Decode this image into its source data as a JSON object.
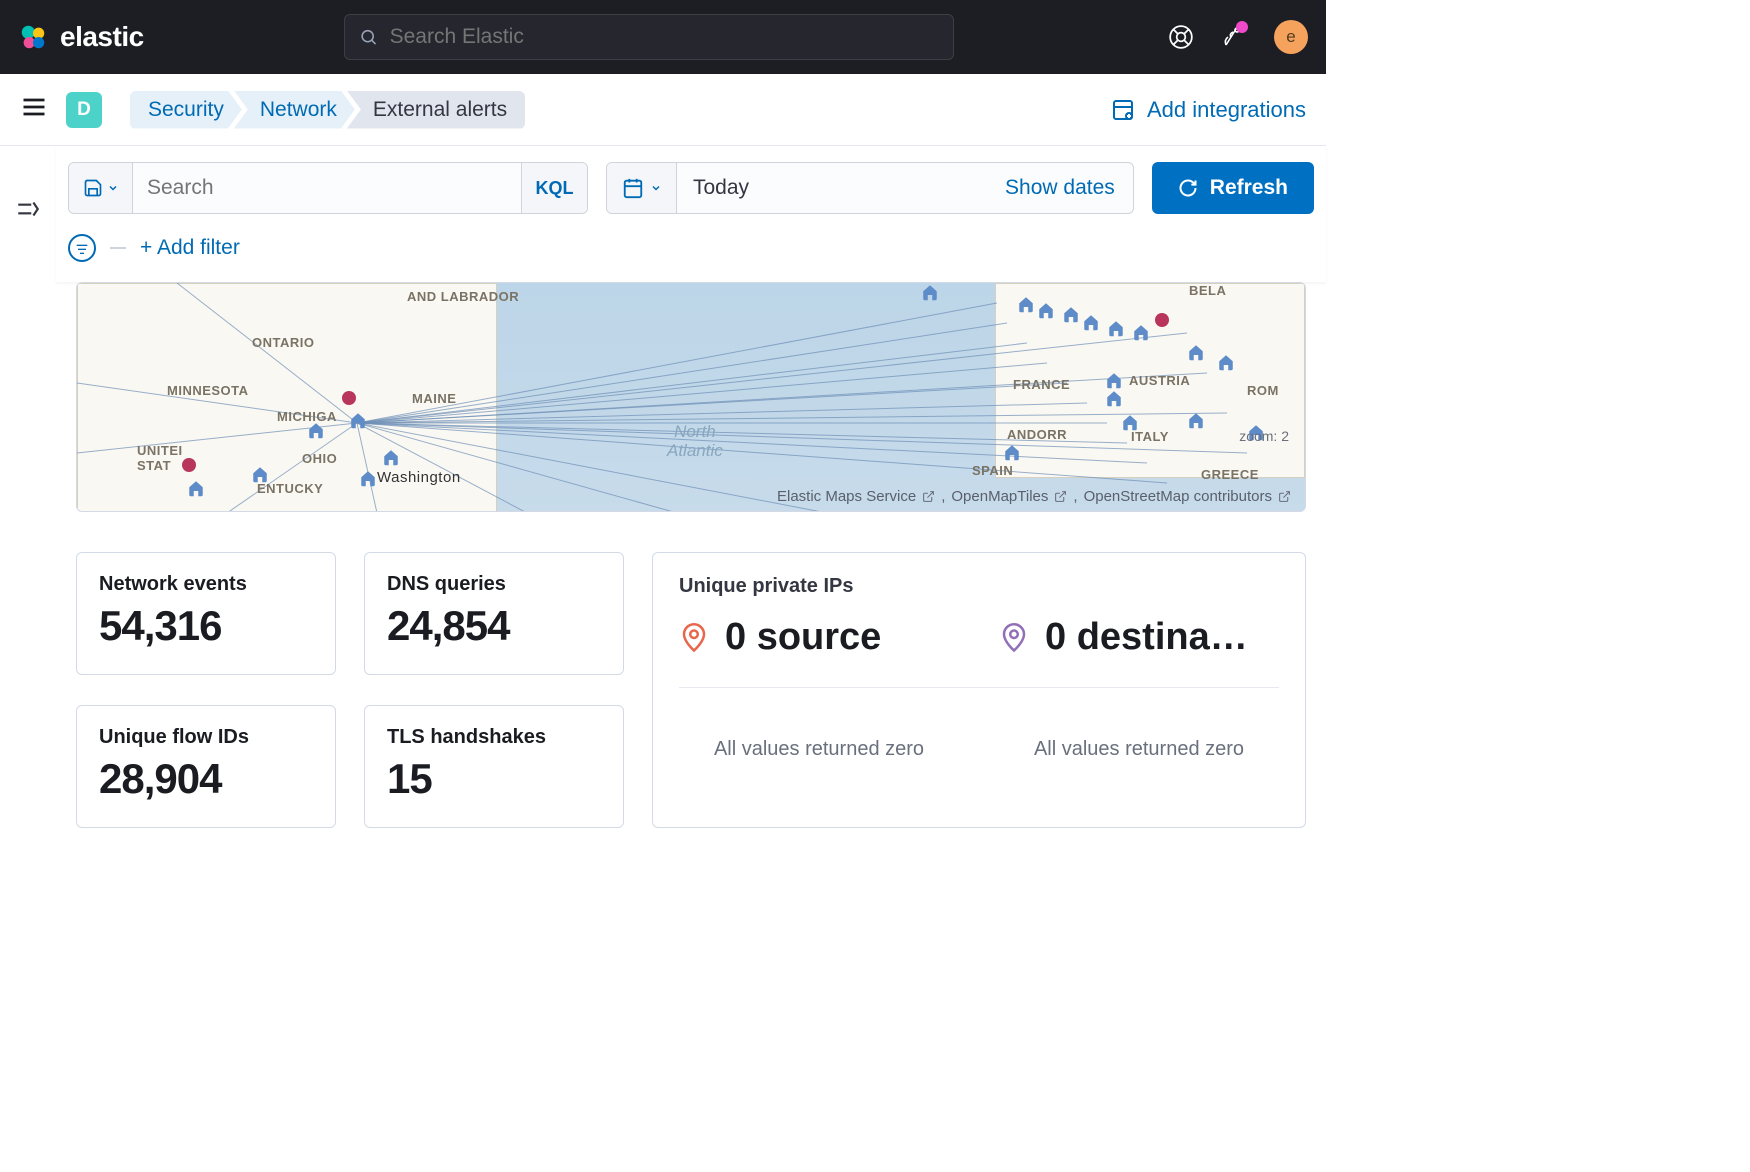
{
  "header": {
    "app_name": "elastic",
    "search_placeholder": "Search Elastic",
    "avatar_letter": "e"
  },
  "subheader": {
    "space_letter": "D",
    "breadcrumbs": [
      "Security",
      "Network",
      "External alerts"
    ],
    "add_integrations": "Add integrations"
  },
  "filterbar": {
    "search_placeholder": "Search",
    "kql_label": "KQL",
    "date_value": "Today",
    "show_dates": "Show dates",
    "refresh": "Refresh",
    "add_filter": "+ Add filter"
  },
  "map": {
    "labels": {
      "and_labrador": "AND LABRADOR",
      "ontario": "ONTARIO",
      "minnesota": "MINNESOTA",
      "michigan": "MICHIGA",
      "maine": "MAINE",
      "ohio": "OHIO",
      "washington": "Washington",
      "united_states": "UNITEI\nSTAT",
      "kentucky": "ENTUCKY",
      "france": "FRANCE",
      "austria": "AUSTRIA",
      "andorra": "ANDORR",
      "italy": "ITALY",
      "spain": "SPAIN",
      "greece": "GREECE",
      "rom": "ROM",
      "bela": "BELA",
      "ocean": "North\nAtlantic"
    },
    "zoom": "zoom: 2",
    "attrib_ems": "Elastic Maps Service",
    "attrib_omt": "OpenMapTiles",
    "attrib_osm": "OpenStreetMap contributors",
    "attrib_sep": ", "
  },
  "stats": {
    "cards": [
      {
        "title": "Network events",
        "value": "54,316"
      },
      {
        "title": "DNS queries",
        "value": "24,854"
      },
      {
        "title": "Unique flow IDs",
        "value": "28,904"
      },
      {
        "title": "TLS handshakes",
        "value": "15"
      }
    ],
    "unique_ips": {
      "title": "Unique private IPs",
      "source": "0 source",
      "destination": "0 destina…",
      "zero_msg": "All values returned zero"
    }
  }
}
